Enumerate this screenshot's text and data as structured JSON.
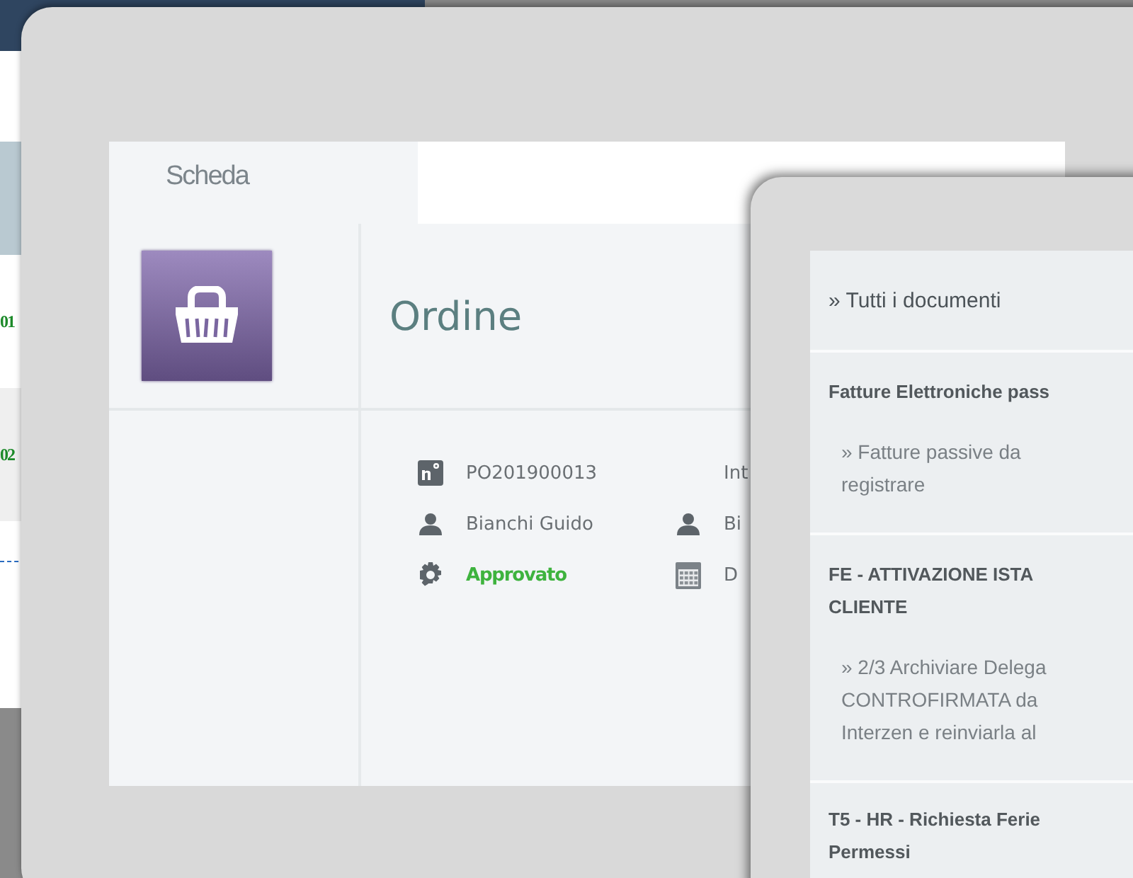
{
  "background_list": {
    "rows": [
      {
        "text": "01"
      },
      {
        "text": "02"
      }
    ]
  },
  "order_card": {
    "tabs": [
      {
        "label": "Scheda",
        "selected": true
      }
    ],
    "title": "Ordine",
    "details": [
      [
        {
          "kind": "number",
          "text": "PO201900013"
        },
        {
          "kind": "plain",
          "text": "Int"
        }
      ],
      [
        {
          "kind": "person",
          "text": "Bianchi Guido"
        },
        {
          "kind": "person",
          "text": "Bi"
        }
      ],
      [
        {
          "kind": "status",
          "text": "Approvato"
        },
        {
          "kind": "date",
          "text": "D"
        }
      ]
    ]
  },
  "documents_panel": {
    "items": [
      {
        "kind": "link",
        "lines": [
          "» Tutti i documenti"
        ]
      },
      {
        "kind": "group",
        "lines": [
          "Fatture Elettroniche pass"
        ]
      },
      {
        "kind": "sublink",
        "lines": [
          "» Fatture passive da",
          "registrare"
        ]
      },
      {
        "kind": "group",
        "lines": [
          "FE - ATTIVAZIONE ISTA",
          "CLIENTE"
        ]
      },
      {
        "kind": "sublink",
        "lines": [
          "» 2/3 Archiviare Delega",
          "CONTROFIRMATA da",
          "Interzen e reinviarla al"
        ]
      },
      {
        "kind": "group",
        "lines": [
          "T5 - HR - Richiesta Ferie",
          "Permessi"
        ]
      }
    ]
  }
}
